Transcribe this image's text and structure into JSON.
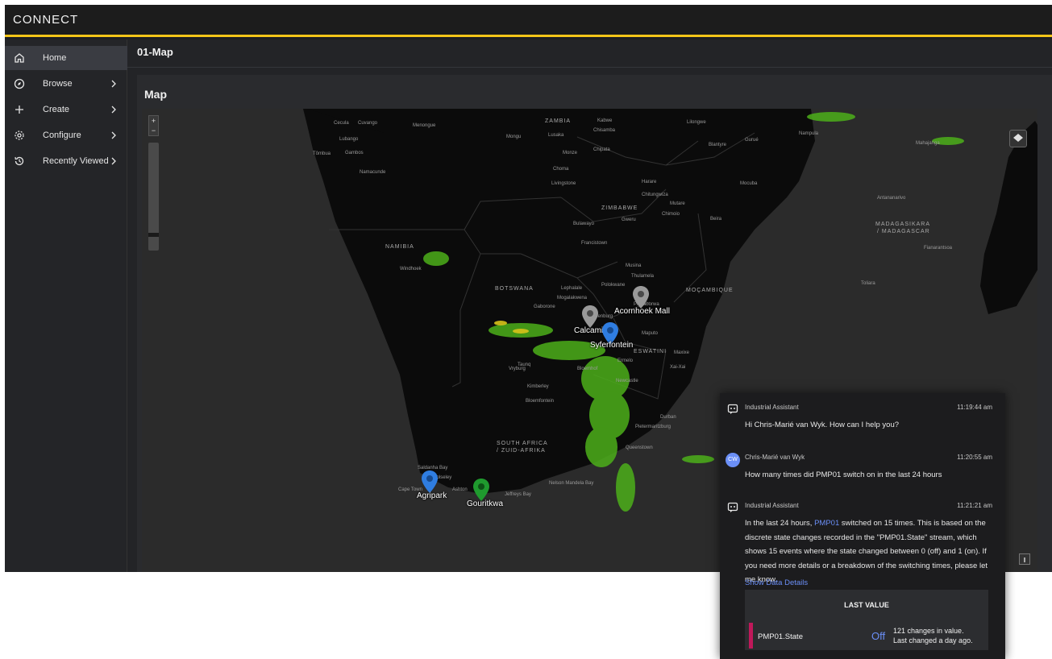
{
  "app": {
    "logo": "CONNECT",
    "accent": "#f5c518"
  },
  "sidebar": {
    "items": [
      {
        "label": "Home",
        "icon": "home-icon",
        "active": true
      },
      {
        "label": "Browse",
        "icon": "compass-icon",
        "has_chevron": true
      },
      {
        "label": "Create",
        "icon": "plus-icon",
        "has_chevron": true
      },
      {
        "label": "Configure",
        "icon": "gear-icon",
        "has_chevron": true
      },
      {
        "label": "Recently Viewed",
        "icon": "history-icon",
        "has_chevron": true
      }
    ]
  },
  "page": {
    "title": "01-Map",
    "panel_title": "Map"
  },
  "map": {
    "zoom_in": "+",
    "zoom_out": "−",
    "countries": [
      "NAMIBIA",
      "BOTSWANA",
      "ZIMBABWE",
      "MOÇAMBIQUE",
      "SOUTH AFRICA",
      "/ ZUID-AFRIKA",
      "ZAMBIA",
      "MADAGASIKARA",
      "/ MADAGASCAR",
      "ESWATINI"
    ],
    "places": [
      "Cecula",
      "Cuvango",
      "Menongue",
      "Lubango",
      "Tômbua",
      "Gambos",
      "Namacunde",
      "Mongu",
      "Lusaka",
      "Kabwe",
      "Chisamba",
      "Chipata",
      "Lilongwe",
      "Blantyre",
      "Nampula",
      "Gurué",
      "Mocuba",
      "Monze",
      "Choma",
      "Livingstone",
      "Harare",
      "Chitungwiza",
      "Mutare",
      "Chimoio",
      "Beira",
      "Bulawayo",
      "Gweru",
      "Francistown",
      "Windhoek",
      "Lephalale",
      "Mogalakwena",
      "Polokwane",
      "Musina",
      "Thulamela",
      "Phalaborwa",
      "Gaborone",
      "Lydenburg",
      "Maputo",
      "Vryburg",
      "Kimberley",
      "Bloemfontein",
      "Durban",
      "Pietermaritzburg",
      "Saldanha Bay",
      "Wolseley",
      "Cape Town",
      "Ashton",
      "Jeffreys Bay",
      "Nelson Mandela Bay",
      "Toliara",
      "Fianarantsoa",
      "Antananarivo",
      "Mahajanga",
      "Taunq",
      "Maxixe",
      "Xai-Xai",
      "Ermelo",
      "Newcastle",
      "Bloemhof",
      "Queenstown"
    ],
    "markers": [
      {
        "label": "Acornhoek Mall",
        "color": "#9a9a9a"
      },
      {
        "label": "Calcamite",
        "color": "#9a9a9a"
      },
      {
        "label": "Syferfontein",
        "color": "#2f7de1"
      },
      {
        "label": "Agripark",
        "color": "#2f7de1"
      },
      {
        "label": "Gouritkwa",
        "color": "#1f9a2e"
      }
    ]
  },
  "chat": {
    "messages": [
      {
        "author": "Industrial Assistant",
        "time": "11:19:44 am",
        "text": "Hi Chris-Marié van Wyk.  How can I help you?"
      },
      {
        "author": "Chris-Marié van Wyk",
        "initials": "CW",
        "time": "11:20:55 am",
        "text": "How many times did PMP01 switch on in the last 24 hours"
      },
      {
        "author": "Industrial Assistant",
        "time": "11:21:21 am",
        "text_pre": "In the last 24 hours, ",
        "text_link": "PMP01",
        "text_post": " switched on 15 times. This is based on the discrete state changes recorded in the \"PMP01.State\" stream, which shows 15 events where the state changed between 0 (off) and 1 (on). If you need more details or a breakdown of the switching times, please let me know."
      }
    ],
    "show_details": "Show Data Details",
    "last_value": {
      "header": "LAST VALUE",
      "stream": "PMP01.State",
      "value": "Off",
      "changes_line1": "121 changes in value.",
      "changes_line2": "Last changed a day ago.",
      "bar_color": "#c0185a"
    }
  }
}
